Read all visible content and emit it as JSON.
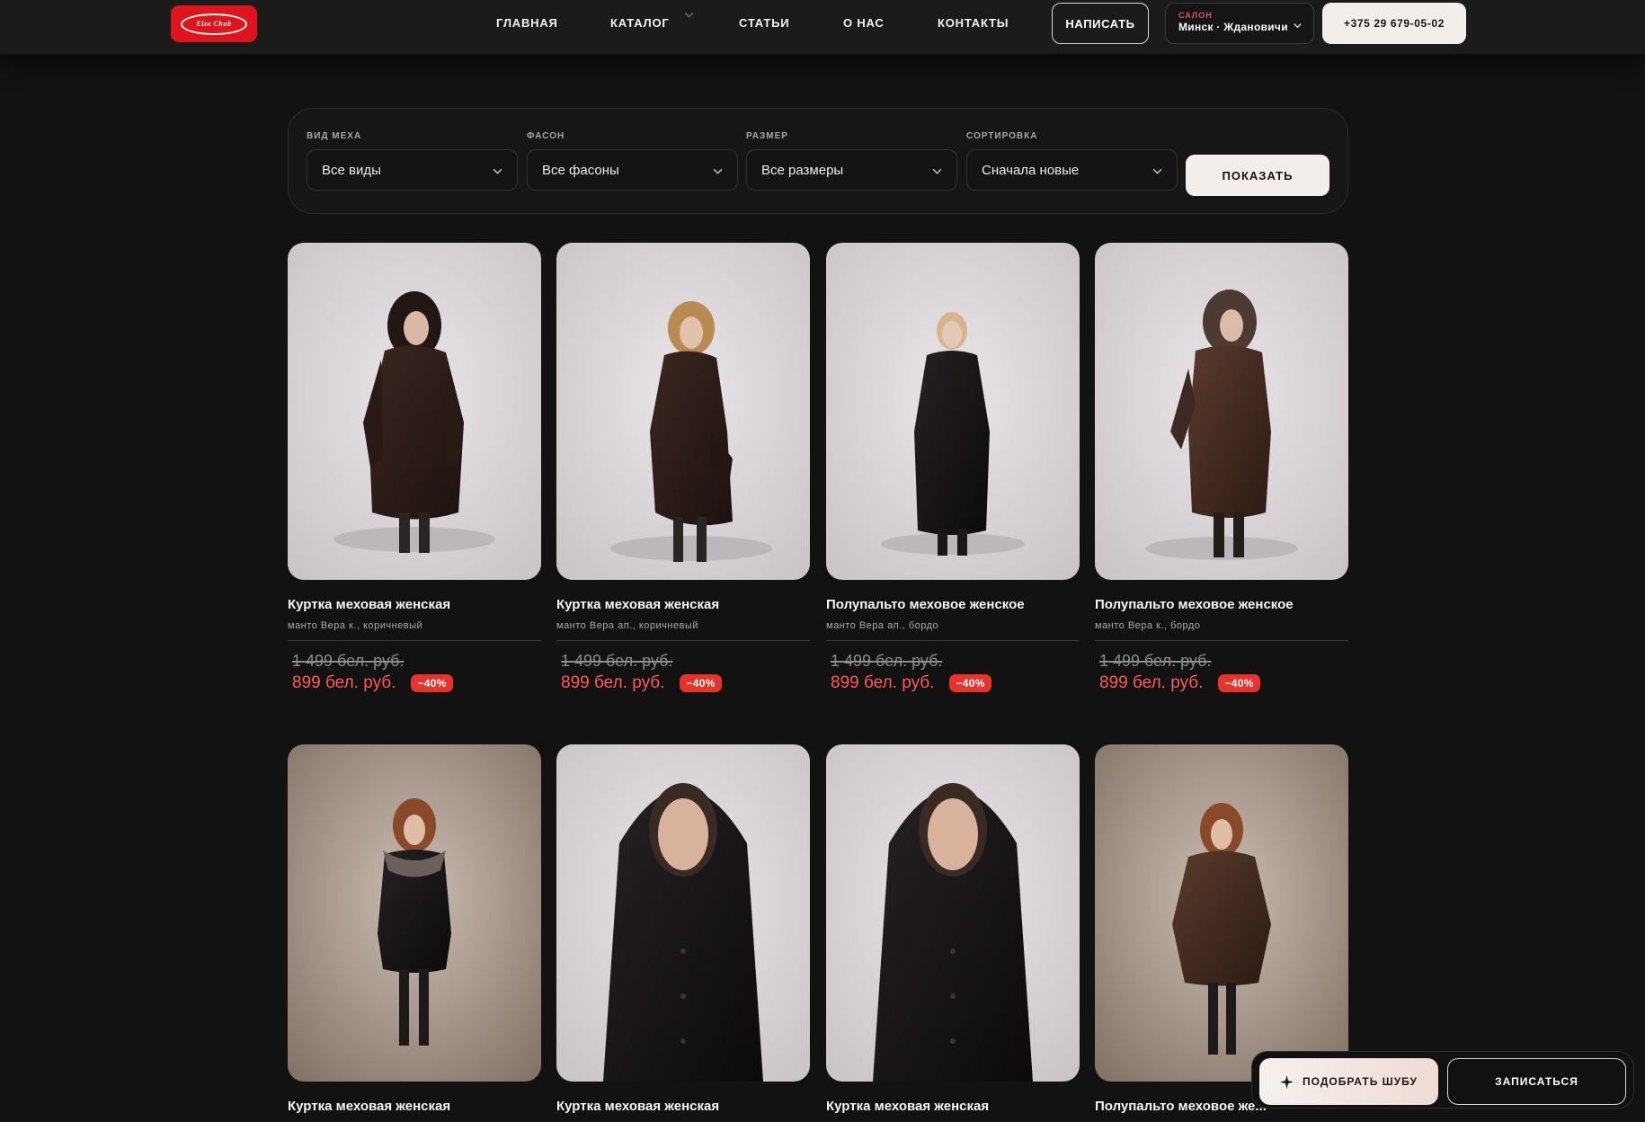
{
  "header": {
    "logo_text": "Elza Chub",
    "nav": [
      {
        "label": "ГЛАВНАЯ"
      },
      {
        "label": "КАТАЛОГ"
      },
      {
        "label": "СТАТЬИ"
      },
      {
        "label": "О НАС"
      },
      {
        "label": "КОНТАКТЫ"
      }
    ],
    "write_label": "НАПИСАТЬ",
    "salon_label": "САЛОН",
    "salon_value": "Минск · Ждановичи",
    "phone": "+375 29 679-05-02"
  },
  "filters": {
    "fur": {
      "label": "ВИД МЕХА",
      "value": "Все виды"
    },
    "style": {
      "label": "ФАСОН",
      "value": "Все фасоны"
    },
    "size": {
      "label": "РАЗМЕР",
      "value": "Все размеры"
    },
    "sort": {
      "label": "СОРТИРОВКА",
      "value": "Сначала новые"
    },
    "show_label": "ПОКАЗАТЬ"
  },
  "products": [
    {
      "title": "Куртка меховая женская",
      "subtitle": "манто Вера к., коричневый",
      "old_price": "1 499 бел. руб.",
      "new_price": "899 бел. руб.",
      "discount": "−40%"
    },
    {
      "title": "Куртка меховая женская",
      "subtitle": "манто Вера ап., коричневый",
      "old_price": "1 499 бел. руб.",
      "new_price": "899 бел. руб.",
      "discount": "−40%"
    },
    {
      "title": "Полупальто меховое женское",
      "subtitle": "манто Вера ап., бордо",
      "old_price": "1 499 бел. руб.",
      "new_price": "899 бел. руб.",
      "discount": "−40%"
    },
    {
      "title": "Полупальто меховое женское",
      "subtitle": "манто Вера к., бордо",
      "old_price": "1 499 бел. руб.",
      "new_price": "899 бел. руб.",
      "discount": "−40%"
    },
    {
      "title": "Куртка меховая женская"
    },
    {
      "title": "Куртка меховая женская"
    },
    {
      "title": "Куртка меховая женская"
    },
    {
      "title": "Полупальто меховое же..."
    }
  ],
  "floating": {
    "pick_label": "ПОДОБРАТЬ ШУБУ",
    "book_label": "ЗАПИСАТЬСЯ"
  },
  "colors": {
    "background": "#121212",
    "accent_red": "#e0141c",
    "sale_price": "#ff5b52",
    "light_button": "#f3eeea"
  }
}
